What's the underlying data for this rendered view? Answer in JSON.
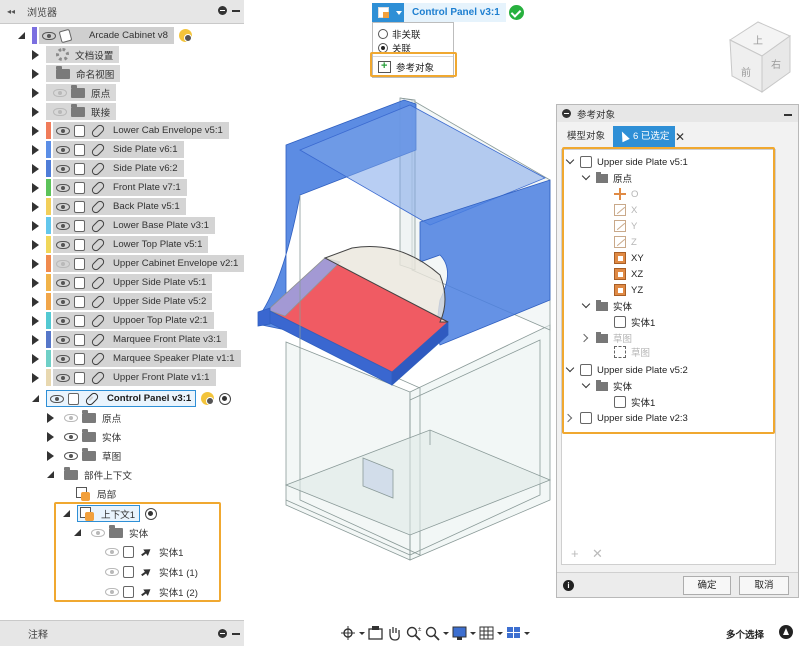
{
  "browser": {
    "title": "浏览器",
    "bottom_title": "注释",
    "root": {
      "label": "Arcade Cabinet v8"
    },
    "items": [
      {
        "label": "文档设置"
      },
      {
        "label": "命名视图"
      },
      {
        "label": "原点"
      },
      {
        "label": "联接"
      },
      {
        "label": "Lower Cab Envelope v5:1",
        "color": "#f07c5a"
      },
      {
        "label": "Side Plate v6:1",
        "color": "#5b8ee6"
      },
      {
        "label": "Side Plate v6:2",
        "color": "#4f7dd8"
      },
      {
        "label": "Front Plate v7:1",
        "color": "#5cc35a"
      },
      {
        "label": "Back Plate v5:1",
        "color": "#f2cf5a"
      },
      {
        "label": "Lower Base Plate v3:1",
        "color": "#63c7ec"
      },
      {
        "label": "Lower Top Plate v5:1",
        "color": "#f0d75a"
      },
      {
        "label": "Upper Cabinet Envelope v2:1",
        "color": "#f08a4e"
      },
      {
        "label": "Upper Side Plate v5:1",
        "color": "#f1b349"
      },
      {
        "label": "Upper Side Plate v5:2",
        "color": "#f1a64a"
      },
      {
        "label": "Uppoer Top Plate v2:1",
        "color": "#53c9d2"
      },
      {
        "label": "Marquee Front Plate v3:1",
        "color": "#5677c9"
      },
      {
        "label": "Marquee Speaker Plate v1:1",
        "color": "#6fd0c7"
      },
      {
        "label": "Upper Front Plate v1:1",
        "color": "#e8d8b0"
      }
    ],
    "active": {
      "label": "Control Panel v3:1"
    },
    "children": [
      {
        "label": "原点"
      },
      {
        "label": "实体"
      },
      {
        "label": "草图"
      },
      {
        "label": "部件上下文"
      },
      {
        "label": "局部"
      }
    ],
    "context": {
      "label": "上下文1",
      "folder": "实体",
      "bodies": [
        "实体1",
        "实体1 (1)",
        "实体1 (2)"
      ]
    }
  },
  "context_dropdown": {
    "name": "Control Panel v3:1",
    "options": [
      "非关联",
      "关联"
    ],
    "selected": "关联",
    "reference_item": "参考对象"
  },
  "viewcube": {
    "top_label": "上",
    "front_label": "前",
    "right_label": "右"
  },
  "ref_panel": {
    "title": "参考对象",
    "tab_model": "模型对象",
    "tab_selected": "6 已选定",
    "tree": {
      "comp1": "Upper side Plate v5:1",
      "origin": "原点",
      "origin_items": [
        "O",
        "X",
        "Y",
        "Z",
        "XY",
        "XZ",
        "YZ"
      ],
      "bodies": "实体",
      "body1": "实体1",
      "sketches": "草图",
      "sketch1": "草图",
      "comp2": "Upper side Plate v5:2",
      "comp2_bodies": "实体",
      "comp2_body1": "实体1",
      "comp3": "Upper side Plate v2:3"
    },
    "ok": "确定",
    "cancel": "取消"
  },
  "status_bar": {
    "multi_select": "多个选择"
  }
}
